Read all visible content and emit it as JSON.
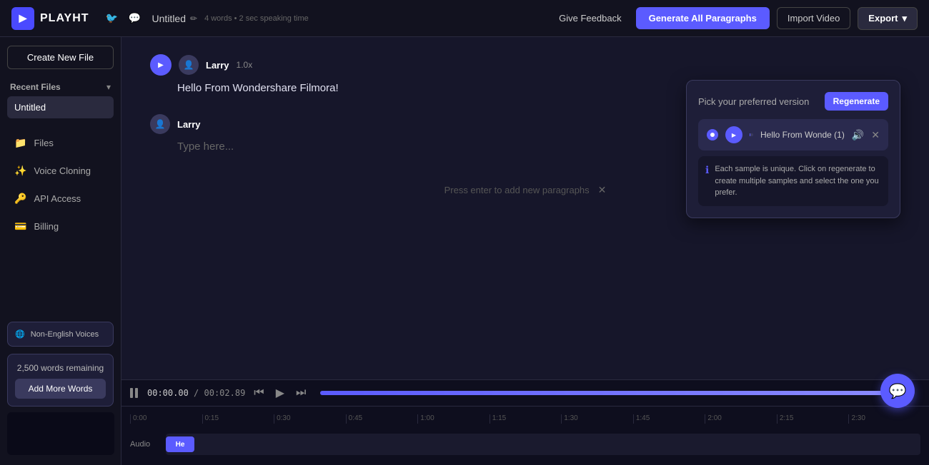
{
  "topbar": {
    "logo": "▶",
    "logo_text": "PLAYHT",
    "twitter_icon": "🐦",
    "discord_icon": "💬",
    "file_title": "Untitled",
    "file_meta": "4 words • 2 sec speaking time",
    "edit_icon": "✏",
    "feedback_label": "Give Feedback",
    "generate_label": "Generate All Paragraphs",
    "import_label": "Import Video",
    "export_label": "Export",
    "export_chevron": "▾"
  },
  "sidebar": {
    "create_btn": "Create New File",
    "recent_label": "Recent Files",
    "recent_chevron": "▾",
    "recent_files": [
      {
        "name": "Untitled"
      }
    ],
    "nav_items": [
      {
        "icon": "📁",
        "label": "Files"
      },
      {
        "icon": "✨",
        "label": "Voice Cloning"
      },
      {
        "icon": "🔑",
        "label": "API Access"
      },
      {
        "icon": "💳",
        "label": "Billing"
      }
    ],
    "non_english_icon": "🌐",
    "non_english_label": "Non-English Voices",
    "words_remaining": "2,500 words remaining",
    "add_words_label": "Add More Words"
  },
  "editor": {
    "paragraph1": {
      "voice_name": "Larry",
      "speed": "1.0x",
      "text": "Hello From Wondershare Filmora!"
    },
    "paragraph2": {
      "voice_name": "Larry",
      "placeholder": "Type here..."
    },
    "hint": "Press enter to add new paragraphs"
  },
  "version_popover": {
    "title": "Pick your preferred version",
    "regen_btn": "Regenerate",
    "version_label": "Hello From Wonde (1)",
    "progress_pct": 15,
    "info_text": "Each sample is unique. Click on regenerate to create multiple samples and select the one you prefer."
  },
  "timeline": {
    "pause_icon": "⏸",
    "timecode_current": "00:00.00",
    "timecode_total": "00:02.89",
    "separator": "/",
    "btn_prev": "⏮",
    "btn_play": "▶",
    "btn_next": "⏭",
    "ruler_marks": [
      "0:00",
      "0:15",
      "0:30",
      "0:45",
      "1:00",
      "1:15",
      "1:30",
      "1:45",
      "2:00",
      "2:15",
      "2:30"
    ],
    "track_label": "Audio",
    "track_clip_label": "He"
  },
  "chat_fab": "💬"
}
